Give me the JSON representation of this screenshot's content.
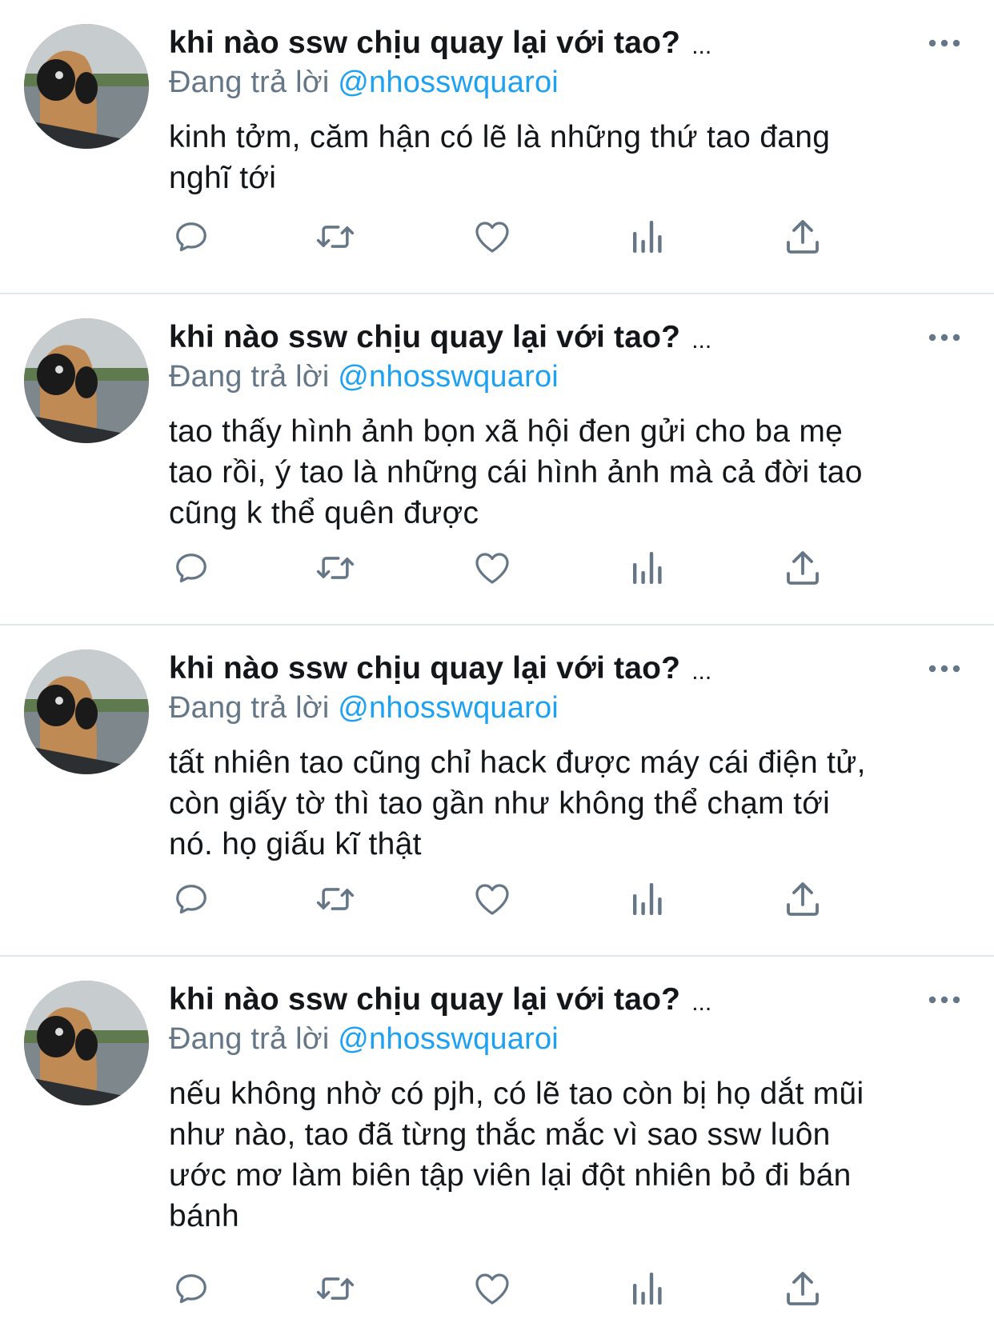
{
  "colors": {
    "text": "#14171a",
    "secondary": "#657786",
    "link": "#1da1f2",
    "divider": "#e1e8ed"
  },
  "icons": {
    "reply": "reply-icon",
    "retweet": "retweet-icon",
    "like": "heart-icon",
    "views": "bar-chart-icon",
    "share": "share-icon",
    "more": "more-horizontal-icon"
  },
  "tweets": [
    {
      "display_name": "khi nào ssw chịu quay lại với tao?",
      "name_truncation": "...",
      "reply_prefix": "Đang trả lời",
      "reply_handle": "@nhosswquaroi",
      "text_lines": [
        "kinh tởm, căm hận có lẽ là những thứ tao đang",
        "nghĩ tới"
      ]
    },
    {
      "display_name": "khi nào ssw chịu quay lại với tao?",
      "name_truncation": "...",
      "reply_prefix": "Đang trả lời",
      "reply_handle": "@nhosswquaroi",
      "text_lines": [
        "tao thấy hình ảnh bọn xã hội đen gửi cho ba mẹ",
        "tao rồi, ý tao là những cái hình ảnh mà cả đời tao",
        "cũng k thể quên được"
      ]
    },
    {
      "display_name": "khi nào ssw chịu quay lại với tao?",
      "name_truncation": "...",
      "reply_prefix": "Đang trả lời",
      "reply_handle": "@nhosswquaroi",
      "text_lines": [
        "tất nhiên tao cũng chỉ hack được máy cái điện tử,",
        "còn giấy tờ thì tao gần như không thể chạm tới",
        "nó. họ giấu kĩ thật"
      ]
    },
    {
      "display_name": "khi nào ssw chịu quay lại với tao?",
      "name_truncation": "...",
      "reply_prefix": "Đang trả lời",
      "reply_handle": "@nhosswquaroi",
      "text_lines": [
        "nếu không nhờ có pjh, có lẽ tao còn bị họ dắt mũi",
        "như nào, tao đã từng thắc mắc vì sao ssw luôn",
        "ước mơ làm biên tập viên lại đột nhiên bỏ đi bán",
        "bánh"
      ]
    }
  ]
}
